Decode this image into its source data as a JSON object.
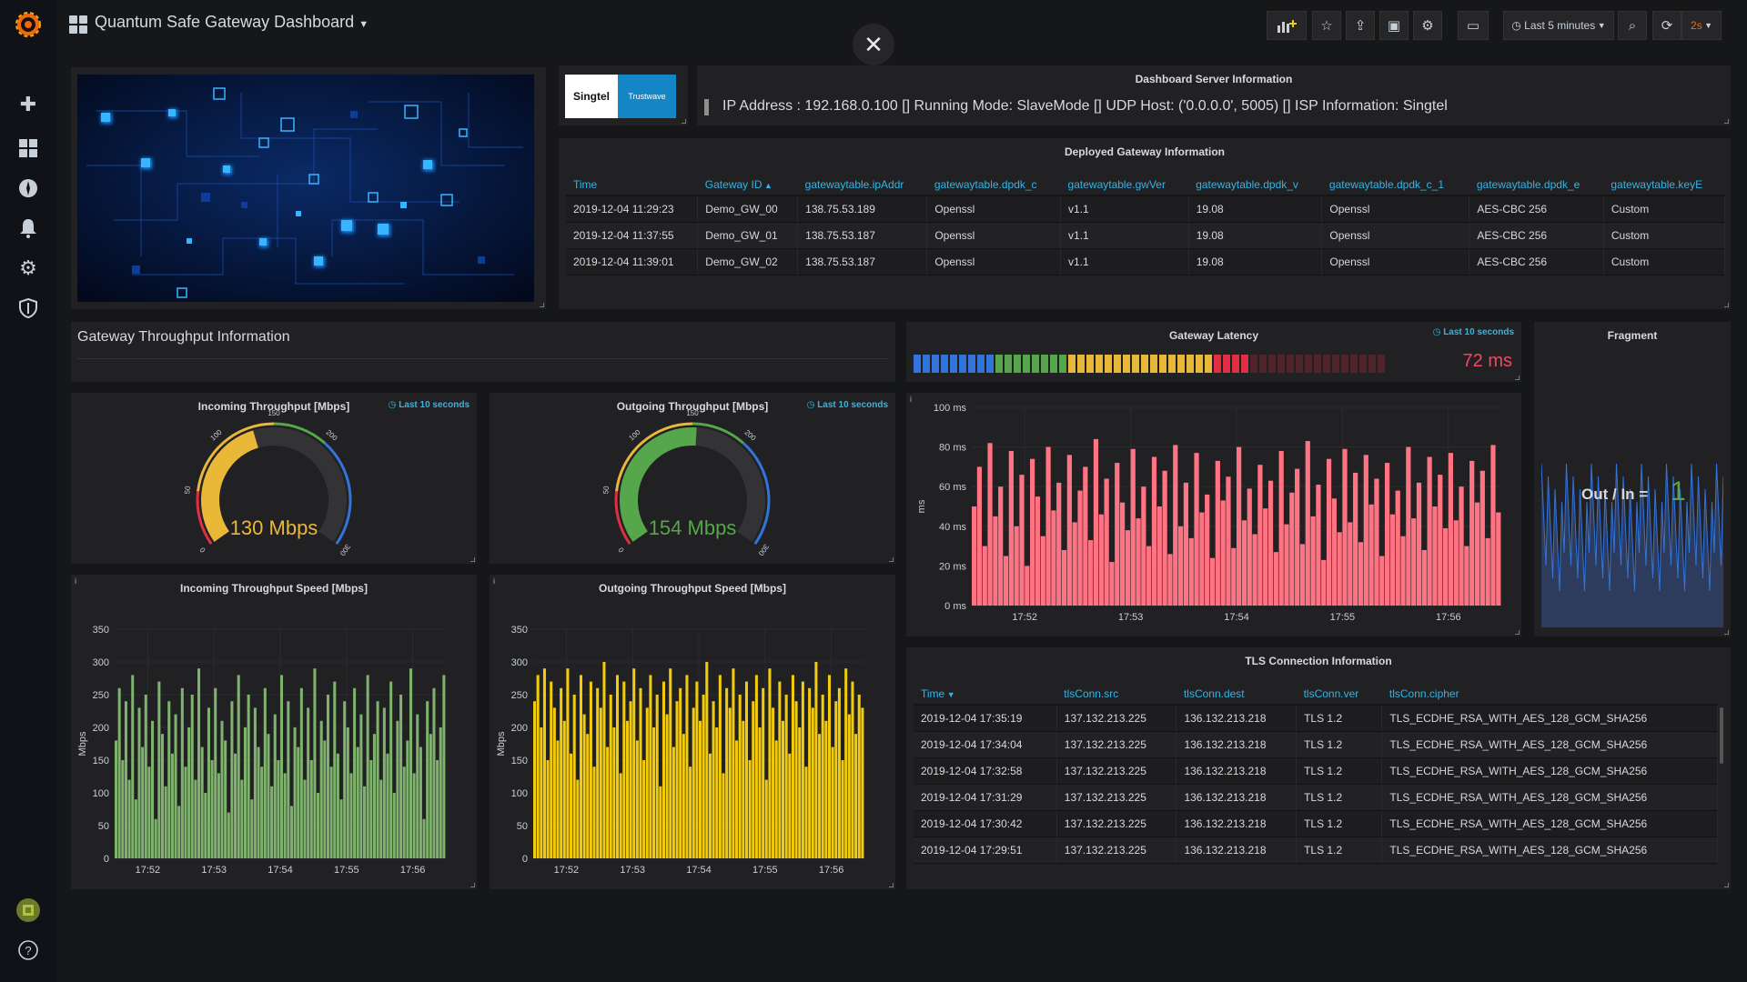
{
  "topbar": {
    "title": "Quantum Safe Gateway Dashboard",
    "time_range": "Last 5 minutes",
    "refresh": "2s"
  },
  "server_info": {
    "title": "Dashboard Server Information",
    "text": "IP Address : 192.168.0.100 [] Running Mode: SlaveMode [] UDP Host: ('0.0.0.0', 5005) [] ISP Information: Singtel",
    "logo_text": "Singtel",
    "logo_sub": "Trustwave"
  },
  "gateway_table": {
    "title": "Deployed Gateway Information",
    "columns": [
      "Time",
      "Gateway ID",
      "gatewaytable.ipAddr",
      "gatewaytable.dpdk_c",
      "gatewaytable.gwVer",
      "gatewaytable.dpdk_v",
      "gatewaytable.dpdk_c_1",
      "gatewaytable.dpdk_e",
      "gatewaytable.keyE"
    ],
    "rows": [
      [
        "2019-12-04 11:29:23",
        "Demo_GW_00",
        "138.75.53.189",
        "Openssl",
        "v1.1",
        "19.08",
        "Openssl",
        "AES-CBC 256",
        "Custom"
      ],
      [
        "2019-12-04 11:37:55",
        "Demo_GW_01",
        "138.75.53.187",
        "Openssl",
        "v1.1",
        "19.08",
        "Openssl",
        "AES-CBC 256",
        "Custom"
      ],
      [
        "2019-12-04 11:39:01",
        "Demo_GW_02",
        "138.75.53.187",
        "Openssl",
        "v1.1",
        "19.08",
        "Openssl",
        "AES-CBC 256",
        "Custom"
      ]
    ]
  },
  "throughput_row": {
    "title": "Gateway Throughput Information"
  },
  "incoming_gauge": {
    "title": "Incoming Throughput [Mbps]",
    "info": "Last 10 seconds",
    "value": 130,
    "value_text": "130 Mbps",
    "color": "#eab839",
    "min": 0,
    "max": 300,
    "ticks": [
      "0",
      "50",
      "100",
      "150",
      "200",
      "300"
    ]
  },
  "outgoing_gauge": {
    "title": "Outgoing Throughput [Mbps]",
    "info": "Last 10 seconds",
    "value": 154,
    "value_text": "154 Mbps",
    "color": "#56a64b",
    "min": 0,
    "max": 300,
    "ticks": [
      "0",
      "50",
      "100",
      "150",
      "200",
      "300"
    ]
  },
  "latency": {
    "title": "Gateway Latency",
    "info": "Last 10 seconds",
    "value_text": "72 ms",
    "value": 72,
    "max": 100
  },
  "fragment": {
    "title": "Fragment",
    "label": "Out / In =",
    "value": "1"
  },
  "chart_data": [
    {
      "type": "bar",
      "title": "Incoming Throughput Speed [Mbps]",
      "ylabel": "Mbps",
      "ylim": [
        0,
        350
      ],
      "yticks": [
        "0",
        "50",
        "100",
        "150",
        "200",
        "250",
        "300",
        "350"
      ],
      "xticks": [
        "17:52",
        "17:53",
        "17:54",
        "17:55",
        "17:56"
      ],
      "color": "#7eb26d",
      "values": [
        180,
        260,
        150,
        240,
        120,
        280,
        90,
        230,
        170,
        250,
        140,
        210,
        60,
        270,
        190,
        110,
        240,
        160,
        220,
        80,
        260,
        140,
        200,
        250,
        120,
        290,
        170,
        100,
        230,
        150,
        260,
        130,
        210,
        180,
        70,
        240,
        160,
        280,
        120,
        200,
        250,
        90,
        230,
        170,
        140,
        260,
        190,
        110,
        220,
        150,
        280,
        130,
        240,
        80,
        200,
        170,
        260,
        120,
        230,
        150,
        290,
        100,
        210,
        180,
        250,
        140,
        270,
        160,
        90,
        240,
        200,
        130,
        260,
        170,
        220,
        110,
        280,
        150,
        190,
        240,
        120,
        230,
        160,
        270,
        100,
        210,
        250,
        140,
        180,
        290,
        130,
        220,
        170,
        60,
        240,
        190,
        260,
        150,
        200,
        280
      ]
    },
    {
      "type": "bar",
      "title": "Outgoing Throughput Speed [Mbps]",
      "ylabel": "Mbps",
      "ylim": [
        0,
        350
      ],
      "yticks": [
        "0",
        "50",
        "100",
        "150",
        "200",
        "250",
        "300",
        "350"
      ],
      "xticks": [
        "17:52",
        "17:53",
        "17:54",
        "17:55",
        "17:56"
      ],
      "color": "#f2cc0c",
      "values": [
        240,
        280,
        200,
        290,
        150,
        270,
        230,
        180,
        260,
        210,
        290,
        160,
        250,
        120,
        280,
        220,
        190,
        270,
        140,
        260,
        230,
        300,
        170,
        250,
        200,
        280,
        130,
        270,
        210,
        240,
        290,
        180,
        260,
        150,
        230,
        280,
        200,
        250,
        110,
        270,
        220,
        290,
        170,
        240,
        260,
        190,
        280,
        140,
        230,
        270,
        210,
        250,
        300,
        160,
        240,
        200,
        280,
        130,
        260,
        230,
        290,
        180,
        250,
        210,
        270,
        150,
        240,
        280,
        200,
        260,
        120,
        290,
        230,
        180,
        270,
        210,
        250,
        160,
        280,
        240,
        200,
        270,
        140,
        260,
        230,
        300,
        190,
        250,
        210,
        280,
        170,
        240,
        260,
        150,
        290,
        220,
        270,
        190,
        250,
        230
      ]
    },
    {
      "type": "bar",
      "title": "",
      "ylabel": "ms",
      "ylim": [
        0,
        100
      ],
      "yticks": [
        "0 ms",
        "20 ms",
        "40 ms",
        "60 ms",
        "80 ms",
        "100 ms"
      ],
      "xticks": [
        "17:52",
        "17:53",
        "17:54",
        "17:55",
        "17:56"
      ],
      "color": "#ff7383",
      "values": [
        50,
        70,
        30,
        82,
        45,
        60,
        25,
        78,
        40,
        66,
        20,
        74,
        55,
        35,
        80,
        48,
        62,
        28,
        76,
        42,
        58,
        70,
        33,
        84,
        46,
        64,
        22,
        72,
        52,
        38,
        79,
        44,
        60,
        30,
        75,
        50,
        68,
        26,
        81,
        40,
        62,
        34,
        77,
        47,
        56,
        24,
        73,
        53,
        65,
        29,
        80,
        43,
        59,
        36,
        71,
        49,
        63,
        27,
        78,
        41,
        57,
        69,
        31,
        83,
        45,
        61,
        23,
        74,
        54,
        37,
        79,
        42,
        67,
        32,
        76,
        51,
        64,
        25,
        72,
        46,
        58,
        35,
        80,
        44,
        62,
        28,
        75,
        50,
        66,
        39,
        77,
        43,
        60,
        30,
        73,
        52,
        68,
        34,
        81,
        47
      ]
    }
  ],
  "tls_table": {
    "title": "TLS Connection Information",
    "columns": [
      "Time",
      "tlsConn.src",
      "tlsConn.dest",
      "tlsConn.ver",
      "tlsConn.cipher"
    ],
    "rows": [
      [
        "2019-12-04 17:35:19",
        "137.132.213.225",
        "136.132.213.218",
        "TLS 1.2",
        "TLS_ECDHE_RSA_WITH_AES_128_GCM_SHA256"
      ],
      [
        "2019-12-04 17:34:04",
        "137.132.213.225",
        "136.132.213.218",
        "TLS 1.2",
        "TLS_ECDHE_RSA_WITH_AES_128_GCM_SHA256"
      ],
      [
        "2019-12-04 17:32:58",
        "137.132.213.225",
        "136.132.213.218",
        "TLS 1.2",
        "TLS_ECDHE_RSA_WITH_AES_128_GCM_SHA256"
      ],
      [
        "2019-12-04 17:31:29",
        "137.132.213.225",
        "136.132.213.218",
        "TLS 1.2",
        "TLS_ECDHE_RSA_WITH_AES_128_GCM_SHA256"
      ],
      [
        "2019-12-04 17:30:42",
        "137.132.213.225",
        "136.132.213.218",
        "TLS 1.2",
        "TLS_ECDHE_RSA_WITH_AES_128_GCM_SHA256"
      ],
      [
        "2019-12-04 17:29:51",
        "137.132.213.225",
        "136.132.213.218",
        "TLS 1.2",
        "TLS_ECDHE_RSA_WITH_AES_128_GCM_SHA256"
      ]
    ]
  }
}
